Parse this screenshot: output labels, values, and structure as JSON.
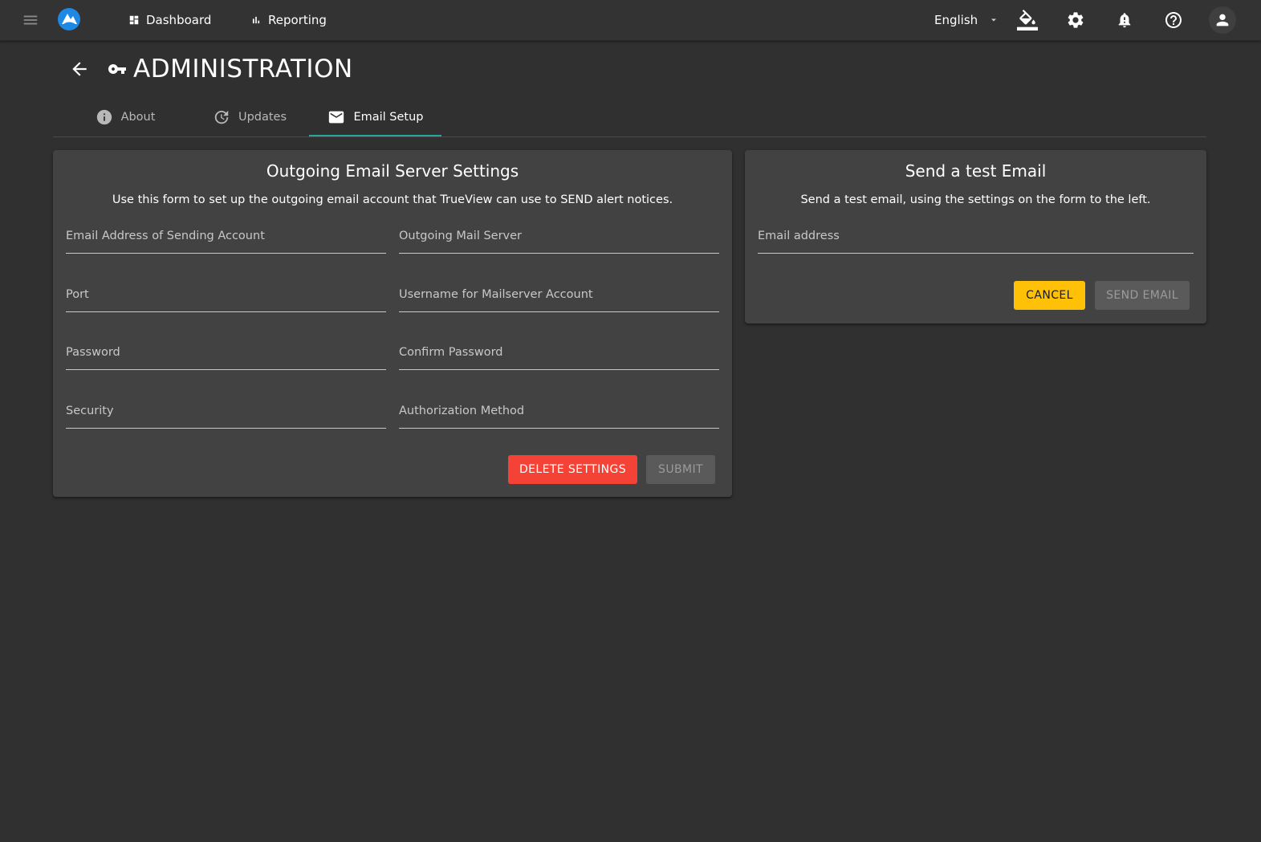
{
  "topbar": {
    "nav": [
      {
        "label": "Dashboard",
        "icon": "dashboard-icon"
      },
      {
        "label": "Reporting",
        "icon": "bar-chart-icon"
      }
    ],
    "language": "English",
    "logo_color": "#1e88e5"
  },
  "page": {
    "title": "ADMINISTRATION"
  },
  "tabs": [
    {
      "label": "About",
      "icon": "info-icon"
    },
    {
      "label": "Updates",
      "icon": "update-icon"
    },
    {
      "label": "Email Setup",
      "icon": "mail-icon",
      "active": true
    }
  ],
  "server_settings": {
    "title": "Outgoing Email Server Settings",
    "description": "Use this form to set up the outgoing email account that TrueView can use to SEND alert notices.",
    "fields": [
      {
        "label": "Email Address of Sending Account",
        "value": ""
      },
      {
        "label": "Outgoing Mail Server",
        "value": ""
      },
      {
        "label": "Port",
        "value": ""
      },
      {
        "label": "Username for Mailserver Account",
        "value": ""
      },
      {
        "label": "Password",
        "value": ""
      },
      {
        "label": "Confirm Password",
        "value": ""
      },
      {
        "label": "Security",
        "value": ""
      },
      {
        "label": "Authorization Method",
        "value": ""
      }
    ],
    "delete_label": "DELETE SETTINGS",
    "submit_label": "SUBMIT"
  },
  "test_email": {
    "title": "Send a test Email",
    "description": "Send a test email, using the settings on the form to the left.",
    "field_label": "Email address",
    "field_value": "",
    "cancel_label": "CANCEL",
    "send_label": "SEND EMAIL"
  },
  "colors": {
    "accent_tab": "#26a69a",
    "delete": "#f44336",
    "cancel": "#ffc107"
  }
}
